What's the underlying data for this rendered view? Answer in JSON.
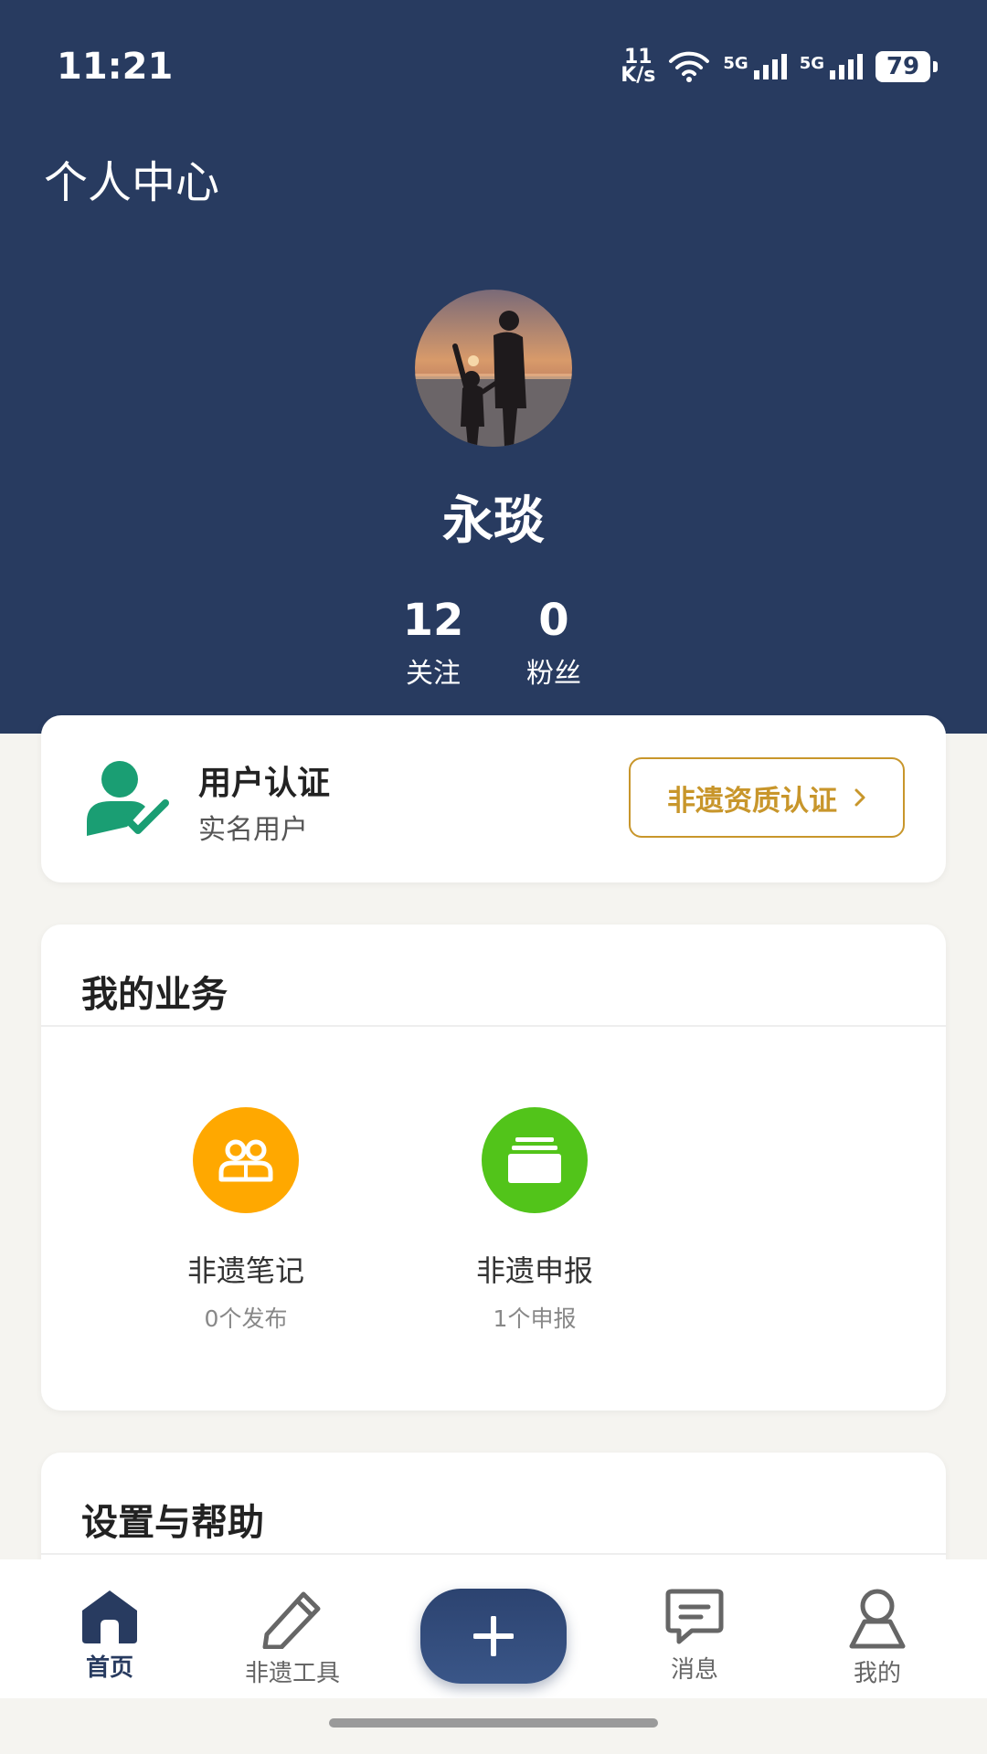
{
  "status_bar": {
    "time": "11:21",
    "net_speed_value": "11",
    "net_speed_unit": "K/s",
    "signal1_label": "5G",
    "signal2_label": "5G",
    "battery": "79"
  },
  "header": {
    "title": "个人中心",
    "username": "永琰",
    "stats": {
      "following_count": "12",
      "following_label": "关注",
      "fans_count": "0",
      "fans_label": "粉丝"
    }
  },
  "verification": {
    "title": "用户认证",
    "subtitle": "实名用户",
    "button_label": "非遗资质认证",
    "icon": "user-check-icon",
    "icon_color": "#1a9e73",
    "button_color": "#c8962b"
  },
  "business": {
    "title": "我的业务",
    "items": [
      {
        "label": "非遗笔记",
        "count": "0个发布",
        "icon": "people-icon",
        "color": "#ffa800"
      },
      {
        "label": "非遗申报",
        "count": "1个申报",
        "icon": "stack-icon",
        "color": "#52c41a"
      }
    ]
  },
  "settings": {
    "title": "设置与帮助"
  },
  "tabbar": {
    "tabs": [
      {
        "label": "首页",
        "icon": "home-icon",
        "active": true
      },
      {
        "label": "非遗工具",
        "icon": "pencil-icon",
        "active": false
      },
      {
        "label": "消息",
        "icon": "message-icon",
        "active": false
      },
      {
        "label": "我的",
        "icon": "user-icon",
        "active": false
      }
    ],
    "add_icon": "plus-icon"
  },
  "colors": {
    "header_bg": "#283b60",
    "page_bg": "#f5f4f0"
  }
}
